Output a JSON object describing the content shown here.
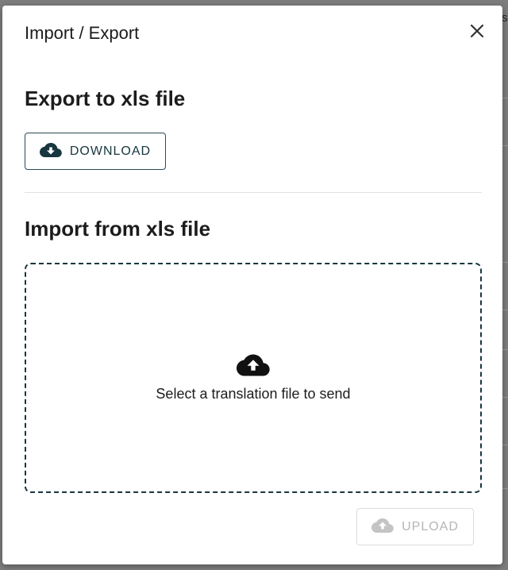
{
  "backdrop": {
    "edge_text": "s"
  },
  "dialog": {
    "title": "Import / Export",
    "close_icon": "close-icon"
  },
  "export": {
    "heading": "Export to xls file",
    "download_label": "DOWNLOAD",
    "download_icon": "cloud-download-icon"
  },
  "import": {
    "heading": "Import from xls file",
    "dropzone_text": "Select a translation file to send",
    "dropzone_icon": "cloud-upload-icon",
    "upload_label": "UPLOAD",
    "upload_icon": "cloud-upload-icon",
    "upload_disabled": true
  },
  "colors": {
    "accent": "#173640",
    "disabled": "#b6b6b6",
    "backdrop": "#7d7d7d"
  }
}
